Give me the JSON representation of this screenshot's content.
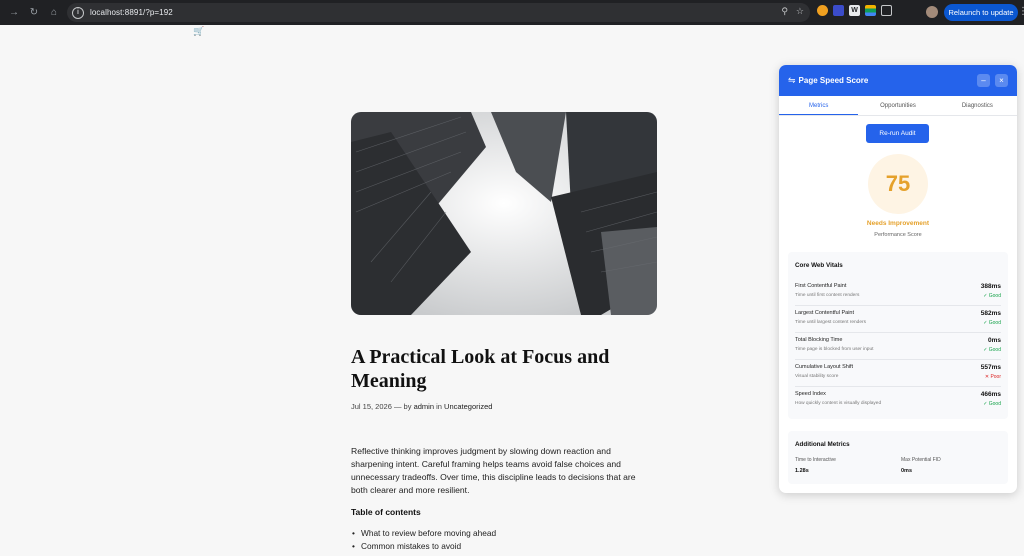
{
  "browser": {
    "url": "localhost:8891/?p=192",
    "relaunch_label": "Relaunch to update",
    "extension_letter": "W"
  },
  "post": {
    "title": "A Practical Look at Focus and Meaning",
    "date": "Jul 15, 2026",
    "by": "— by",
    "author": "admin",
    "in": "in",
    "category": "Uncategorized",
    "paragraph": "Reflective thinking improves judgment by slowing down reaction and sharpening intent. Careful framing helps teams avoid false choices and unnecessary tradeoffs. Over time, this discipline leads to decisions that are both clearer and more resilient.",
    "toc_title": "Table of contents",
    "toc": [
      "What to review before moving ahead",
      "Common mistakes to avoid"
    ]
  },
  "panel": {
    "title": "Page Speed Score",
    "minimize": "–",
    "close": "×",
    "tabs": [
      "Metrics",
      "Opportunities",
      "Diagnostics"
    ],
    "active_tab": "Metrics",
    "rerun_label": "Re-run Audit",
    "score": "75",
    "score_status": "Needs Improvement",
    "score_caption": "Performance Score",
    "cwv_title": "Core Web Vitals",
    "metrics": [
      {
        "name": "First Contentful Paint",
        "desc": "Time until first content renders",
        "value": "388ms",
        "status": "✓ Good",
        "level": "good"
      },
      {
        "name": "Largest Contentful Paint",
        "desc": "Time until largest content renders",
        "value": "582ms",
        "status": "✓ Good",
        "level": "good"
      },
      {
        "name": "Total Blocking Time",
        "desc": "Time page is blocked from user input",
        "value": "0ms",
        "status": "✓ Good",
        "level": "good"
      },
      {
        "name": "Cumulative Layout Shift",
        "desc": "Visual stability score",
        "value": "557ms",
        "status": "✕ Poor",
        "level": "poor"
      },
      {
        "name": "Speed Index",
        "desc": "How quickly content is visually displayed",
        "value": "466ms",
        "status": "✓ Good",
        "level": "good"
      }
    ],
    "additional_title": "Additional Metrics",
    "tti_label": "Time to Interactive",
    "tti_value": "1.28s",
    "fid_label": "Max Potential FID",
    "fid_value": "0ms"
  },
  "colors": {
    "accent": "#2563eb",
    "score": "#e5a12b",
    "good": "#16a34a",
    "poor": "#dc2626"
  }
}
